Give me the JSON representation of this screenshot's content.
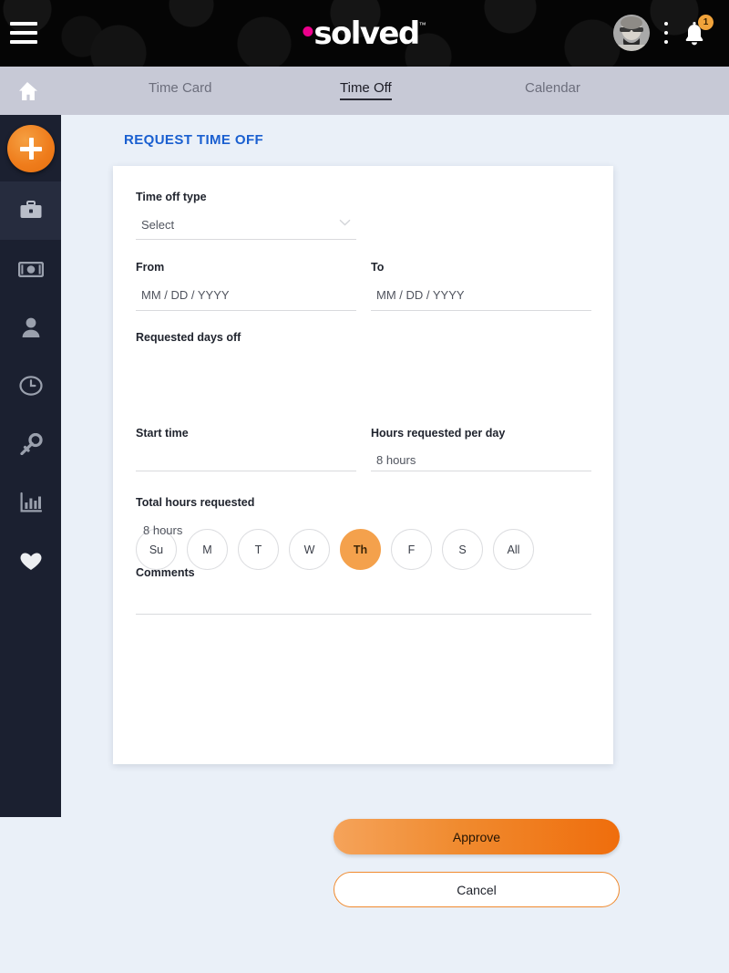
{
  "topbar": {
    "menu_label": "menu",
    "logo_text": "solved",
    "logo_tm": "™",
    "avatar_label": "user avatar",
    "kebab_label": "more options",
    "notification_count": "1"
  },
  "nav": {
    "home_label": "Home",
    "tabs": [
      {
        "label": "Time Card",
        "active": false
      },
      {
        "label": "Time Off",
        "active": true
      },
      {
        "label": "Calendar",
        "active": false
      }
    ]
  },
  "sidebar": {
    "add_label": "+",
    "items": [
      {
        "name": "briefcase",
        "label": "Employment",
        "active": true
      },
      {
        "name": "cash",
        "label": "Pay",
        "active": false
      },
      {
        "name": "person",
        "label": "Personal",
        "active": false
      },
      {
        "name": "clock",
        "label": "Time",
        "active": false
      },
      {
        "name": "key",
        "label": "Access",
        "active": false
      },
      {
        "name": "chart",
        "label": "Reports",
        "active": false
      },
      {
        "name": "heart",
        "label": "Benefits",
        "active": false
      }
    ]
  },
  "page": {
    "title": "REQUEST TIME OFF"
  },
  "form": {
    "time_off_type": {
      "label": "Time off type",
      "value": "Select"
    },
    "from": {
      "label": "From",
      "value": "MM / DD / YYYY"
    },
    "to": {
      "label": "To",
      "value": "MM / DD / YYYY"
    },
    "requested_days_off": {
      "label": "Requested days off"
    },
    "days": [
      {
        "label": "Su",
        "selected": false
      },
      {
        "label": "M",
        "selected": false
      },
      {
        "label": "T",
        "selected": false
      },
      {
        "label": "W",
        "selected": false
      },
      {
        "label": "Th",
        "selected": true
      },
      {
        "label": "F",
        "selected": false
      },
      {
        "label": "S",
        "selected": false
      },
      {
        "label": "All",
        "selected": false
      }
    ],
    "start_time": {
      "label": "Start time",
      "value": ""
    },
    "hours_per_day": {
      "label": "Hours requested per day",
      "value": "8 hours"
    },
    "total_hours": {
      "label": "Total hours requested",
      "value": "8 hours"
    },
    "comments": {
      "label": "Comments",
      "value": ""
    },
    "approve_label": "Approve",
    "cancel_label": "Cancel"
  },
  "colors": {
    "accent_orange": "#ef7c1b",
    "title_blue": "#1a5fd0",
    "logo_pink": "#ec008c",
    "sidebar_dark": "#1b2030",
    "nav_gray": "#c7c9d6",
    "page_bg": "#eaf0f8"
  }
}
